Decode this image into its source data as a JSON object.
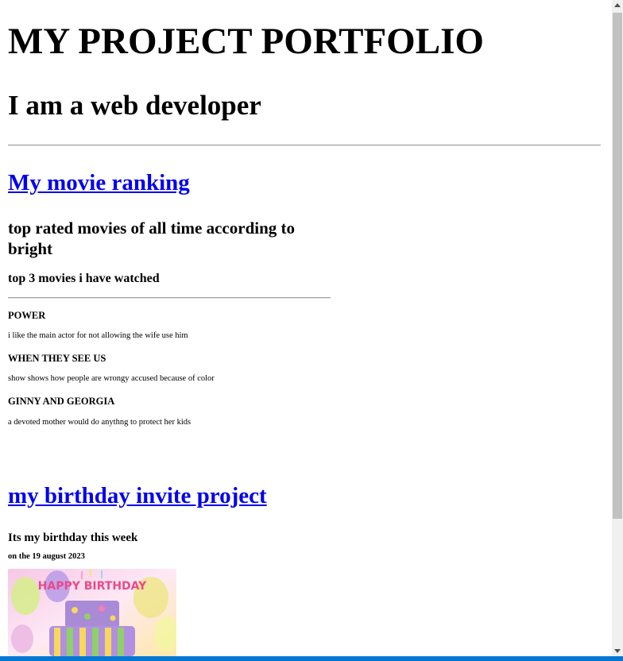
{
  "header": {
    "title": "MY PROJECT PORTFOLIO",
    "subtitle": "I am a web developer"
  },
  "movie_project": {
    "link_label": "My movie ranking",
    "heading": "top rated movies of all time according to bright",
    "subheading": "top 3 movies i have watched",
    "movies": [
      {
        "title": "POWER",
        "description": "i like the main actor for not allowing the wife use him"
      },
      {
        "title": "WHEN THEY SEE US",
        "description": "show shows how people are wrongy accused because of color"
      },
      {
        "title": "GINNY AND GEORGIA",
        "description": "a devoted mother would do anythng to protect her kids"
      }
    ]
  },
  "birthday_project": {
    "link_label": "my birthday invite project",
    "heading": "Its my birthday this week",
    "date": "on the 19 august 2023",
    "image_text": "HAPPY BIRTHDAY"
  },
  "colors": {
    "link": "#0000ee",
    "scroll_thumb": "#c1c1c1",
    "bottom_bar": "#0078d4"
  }
}
